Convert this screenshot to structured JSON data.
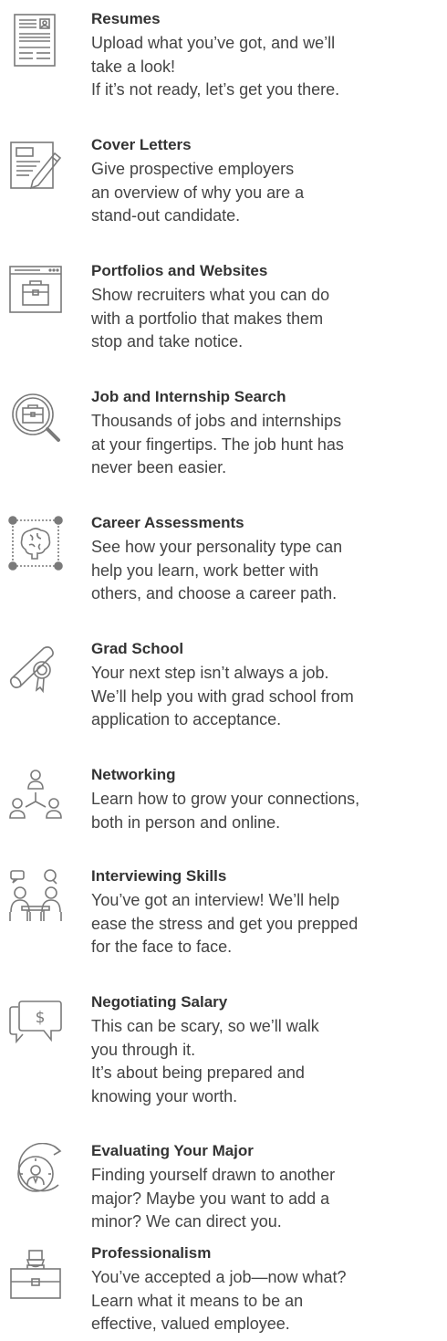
{
  "colors": {
    "icon_stroke": "#7a7a7a",
    "title": "#333333",
    "text": "#444444"
  },
  "items": [
    {
      "icon": "resume-icon",
      "title": "Resumes",
      "lines": [
        "Upload what you’ve got, and we’ll",
        "take a look!",
        "If it’s not ready, let’s get you there."
      ]
    },
    {
      "icon": "cover-letter-icon",
      "title": "Cover Letters",
      "lines": [
        "Give prospective employers",
        "an overview of why you are a",
        "stand-out candidate."
      ]
    },
    {
      "icon": "portfolio-website-icon",
      "title": "Portfolios and Websites",
      "lines": [
        "Show recruiters what you can do",
        "with a portfolio that makes them",
        "stop and take notice."
      ]
    },
    {
      "icon": "job-search-icon",
      "title": "Job and Internship Search",
      "lines": [
        "Thousands of jobs and internships",
        "at your fingertips. The job hunt has",
        "never been easier."
      ]
    },
    {
      "icon": "brain-assessment-icon",
      "title": "Career Assessments",
      "lines": [
        "See how your personality type can",
        "help you learn, work better with",
        "others, and choose a career path."
      ]
    },
    {
      "icon": "diploma-icon",
      "title": "Grad School",
      "lines": [
        "Your next step isn’t always a job.",
        "We’ll help you with grad school from",
        "application to acceptance."
      ]
    },
    {
      "icon": "networking-icon",
      "title": "Networking",
      "lines": [
        "Learn how to grow your connections,",
        "both in person and online."
      ]
    },
    {
      "icon": "interview-icon",
      "title": "Interviewing Skills",
      "lines": [
        "You’ve got an interview! We’ll help",
        "ease the stress and get you prepped",
        "for the face to face."
      ]
    },
    {
      "icon": "salary-chat-icon",
      "title": "Negotiating Salary",
      "lines": [
        "This can be scary, so we’ll walk",
        "you through it.",
        "It’s about being prepared and",
        "knowing your worth."
      ]
    },
    {
      "icon": "evaluate-major-icon",
      "title": "Evaluating Your Major",
      "lines": [
        "Finding yourself drawn to another",
        "major? Maybe you want to add a",
        "minor? We can direct you."
      ]
    },
    {
      "icon": "professional-briefcase-icon",
      "title": "Professionalism",
      "lines": [
        "You’ve accepted a job—now what?",
        "Learn what it means to be an",
        "effective, valued employee."
      ]
    }
  ]
}
